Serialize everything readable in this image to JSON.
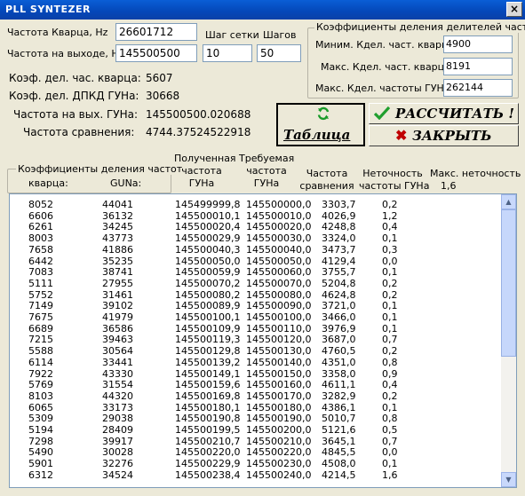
{
  "window": {
    "title": "PLL  SYNTEZER",
    "close": "×"
  },
  "fields": {
    "quartz_freq_label": "Частота Кварца, Hz",
    "quartz_freq_value": "26601712",
    "out_freq_label": "Частота на выходе, Hz",
    "out_freq_value": "145500500",
    "grid_step_label": "Шаг сетки",
    "grid_step_value": "10",
    "steps_label": "Шагов",
    "steps_value": "50"
  },
  "divider_group": {
    "title": "Коэффициенты деления делителей частот",
    "min_quartz_label": "Миним. Кдел. част. кварца:",
    "min_quartz_value": "4900",
    "max_quartz_label": "Макс. Кдел. част. кварца:",
    "max_quartz_value": "8191",
    "max_gun_label": "Макс. Кдел. частоты ГУНа:",
    "max_gun_value": "262144"
  },
  "results": {
    "quartz_coef_label": "Коэф. дел. час. кварца:",
    "quartz_coef_value": "5607",
    "dpkd_label": "Коэф. дел. ДПКД ГУНа:",
    "dpkd_value": "30668",
    "out_gun_label": "Частота на вых. ГУНа:",
    "out_gun_value": "145500500.020688",
    "compare_label": "Частота сравнения:",
    "compare_value": "4744.37524522918"
  },
  "buttons": {
    "table": "Таблица",
    "calculate": "РАССЧИТАТЬ !",
    "close": "ЗАКРЫТЬ"
  },
  "table": {
    "coef_group_title": "Коэффициенты деления частот",
    "col_quartz": "кварца:",
    "col_gun": "GUNa:",
    "h_obt1": "Полученная",
    "h_obt2": "частота",
    "h_obt3": "ГУНа",
    "h_req1": "Требуемая",
    "h_req2": "частота",
    "h_req3": "ГУНа",
    "h_cmp1": "Частота",
    "h_cmp2": "сравнения",
    "h_acc1": "Неточность",
    "h_acc2": "частоты ГУНа",
    "max_err_label": "Макс. неточность :",
    "max_err_value": "1,6",
    "rows": [
      [
        "8052",
        "44041",
        "145499999,8",
        "145500000,0",
        "3303,7",
        "0,2"
      ],
      [
        "6606",
        "36132",
        "145500010,1",
        "145500010,0",
        "4026,9",
        "1,2"
      ],
      [
        "6261",
        "34245",
        "145500020,4",
        "145500020,0",
        "4248,8",
        "0,4"
      ],
      [
        "8003",
        "43773",
        "145500029,9",
        "145500030,0",
        "3324,0",
        "0,1"
      ],
      [
        "7658",
        "41886",
        "145500040,3",
        "145500040,0",
        "3473,7",
        "0,3"
      ],
      [
        "6442",
        "35235",
        "145500050,0",
        "145500050,0",
        "4129,4",
        "0,0"
      ],
      [
        "7083",
        "38741",
        "145500059,9",
        "145500060,0",
        "3755,7",
        "0,1"
      ],
      [
        "5111",
        "27955",
        "145500070,2",
        "145500070,0",
        "5204,8",
        "0,2"
      ],
      [
        "5752",
        "31461",
        "145500080,2",
        "145500080,0",
        "4624,8",
        "0,2"
      ],
      [
        "7149",
        "39102",
        "145500089,9",
        "145500090,0",
        "3721,0",
        "0,1"
      ],
      [
        "7675",
        "41979",
        "145500100,1",
        "145500100,0",
        "3466,0",
        "0,1"
      ],
      [
        "6689",
        "36586",
        "145500109,9",
        "145500110,0",
        "3976,9",
        "0,1"
      ],
      [
        "7215",
        "39463",
        "145500119,3",
        "145500120,0",
        "3687,0",
        "0,7"
      ],
      [
        "5588",
        "30564",
        "145500129,8",
        "145500130,0",
        "4760,5",
        "0,2"
      ],
      [
        "6114",
        "33441",
        "145500139,2",
        "145500140,0",
        "4351,0",
        "0,8"
      ],
      [
        "7922",
        "43330",
        "145500149,1",
        "145500150,0",
        "3358,0",
        "0,9"
      ],
      [
        "5769",
        "31554",
        "145500159,6",
        "145500160,0",
        "4611,1",
        "0,4"
      ],
      [
        "8103",
        "44320",
        "145500169,8",
        "145500170,0",
        "3282,9",
        "0,2"
      ],
      [
        "6065",
        "33173",
        "145500180,1",
        "145500180,0",
        "4386,1",
        "0,1"
      ],
      [
        "5309",
        "29038",
        "145500190,8",
        "145500190,0",
        "5010,7",
        "0,8"
      ],
      [
        "5194",
        "28409",
        "145500199,5",
        "145500200,0",
        "5121,6",
        "0,5"
      ],
      [
        "7298",
        "39917",
        "145500210,7",
        "145500210,0",
        "3645,1",
        "0,7"
      ],
      [
        "5490",
        "30028",
        "145500220,0",
        "145500220,0",
        "4845,5",
        "0,0"
      ],
      [
        "5901",
        "32276",
        "145500229,9",
        "145500230,0",
        "4508,0",
        "0,1"
      ],
      [
        "6312",
        "34524",
        "145500238,4",
        "145500240,0",
        "4214,5",
        "1,6"
      ]
    ]
  }
}
